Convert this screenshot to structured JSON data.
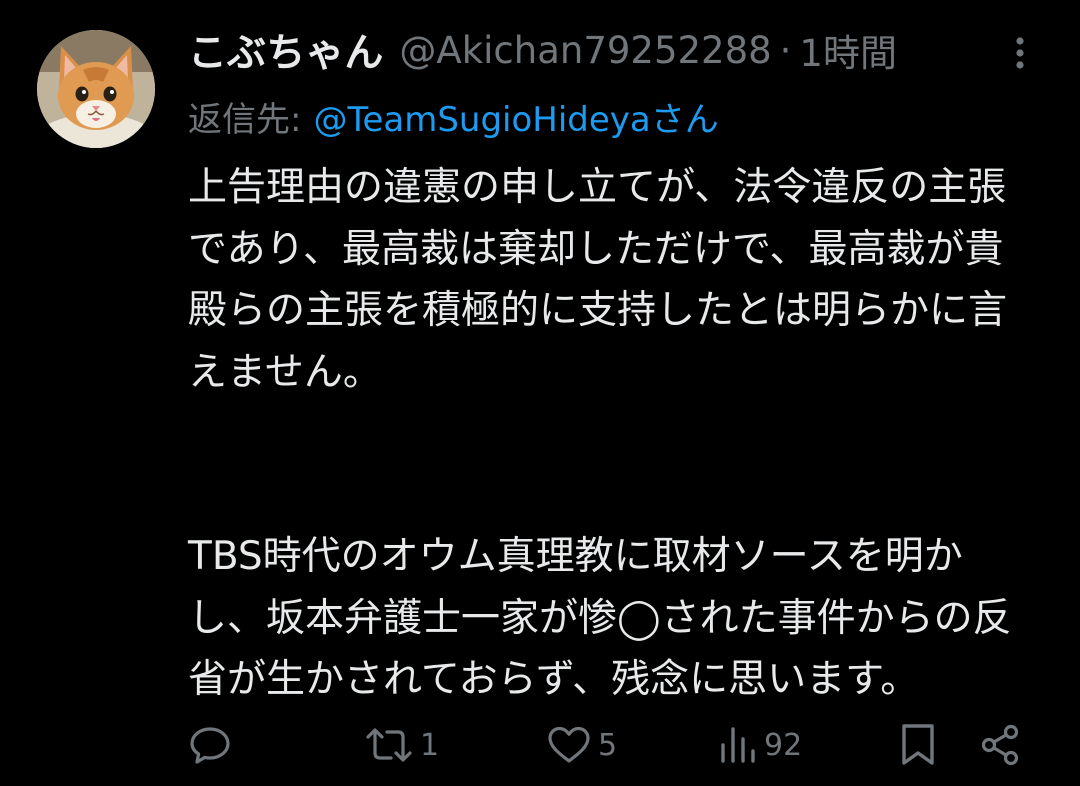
{
  "author": {
    "display_name": "こぶちゃん",
    "handle": "@Akichan79252288",
    "separator": "·",
    "time": "1時間",
    "avatar_icon": "cat-avatar-icon"
  },
  "reply": {
    "prefix": "返信先:",
    "target": "@TeamSugioHideyaさん"
  },
  "body": {
    "paragraphs": [
      "上告理由の違憲の申し立てが、法令違反の主張であり、最高裁は棄却しただけで、最高裁が貴殿らの主張を積極的に支持したとは明らかに言えません。",
      "TBS時代のオウム真理教に取材ソースを明かし、坂本弁護士一家が惨◯された事件からの反省が生かされておらず、残念に思います。"
    ]
  },
  "actions": {
    "reply": {
      "icon": "reply-icon",
      "count": ""
    },
    "retweet": {
      "icon": "retweet-icon",
      "count": "1"
    },
    "like": {
      "icon": "heart-icon",
      "count": "5"
    },
    "views": {
      "icon": "analytics-icon",
      "count": "92"
    },
    "bookmark": {
      "icon": "bookmark-icon"
    },
    "share": {
      "icon": "share-icon"
    }
  },
  "colors": {
    "background": "#000000",
    "text_primary": "#e7e9ea",
    "text_secondary": "#71767b",
    "link": "#1d9bf0"
  }
}
